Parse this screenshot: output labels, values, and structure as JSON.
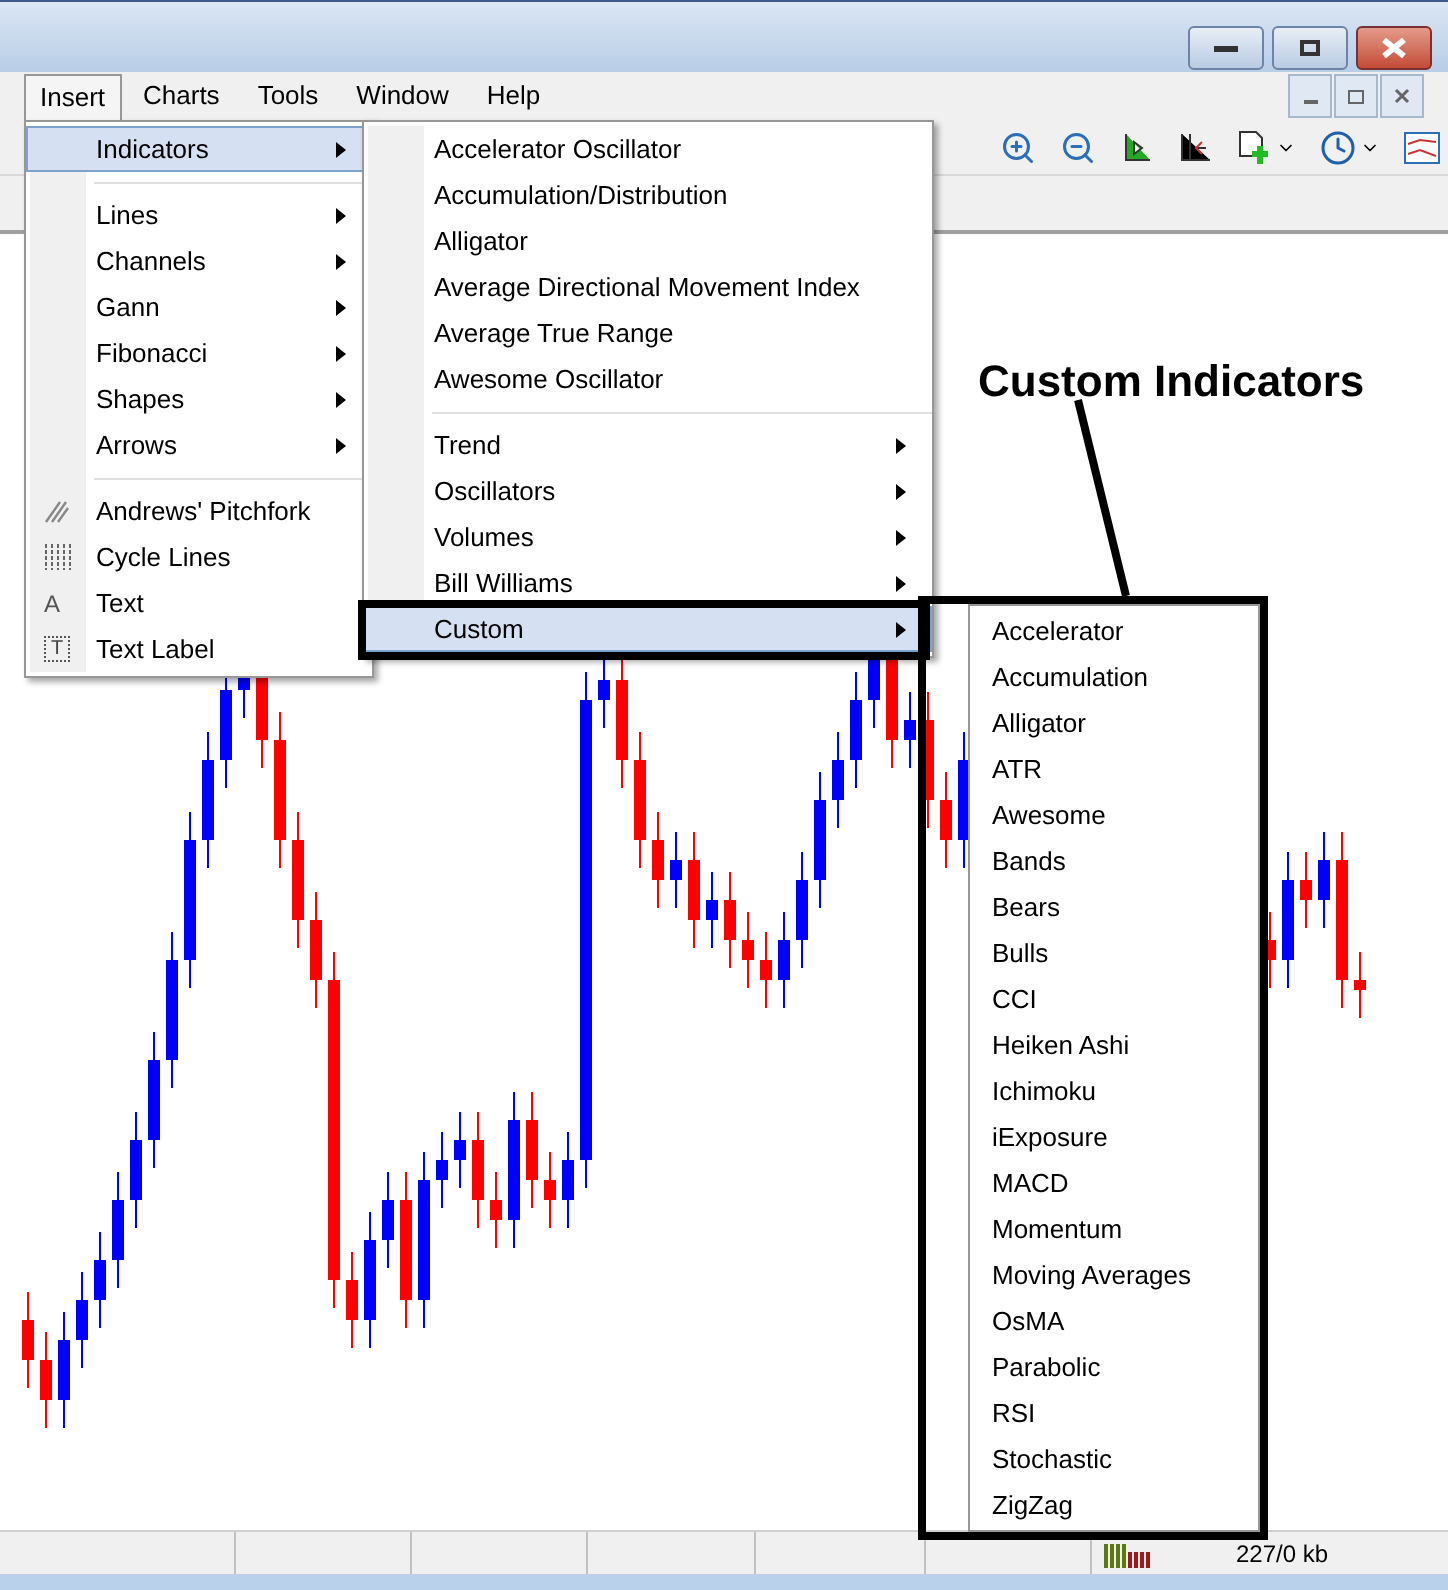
{
  "menu_bar": [
    {
      "label": "Insert",
      "selected": true
    },
    {
      "label": "Charts",
      "selected": false
    },
    {
      "label": "Tools",
      "selected": false
    },
    {
      "label": "Window",
      "selected": false
    },
    {
      "label": "Help",
      "selected": false
    }
  ],
  "insert_menu": {
    "items": [
      {
        "kind": "submenu",
        "label": "Indicators",
        "selected": true
      },
      {
        "kind": "separator"
      },
      {
        "kind": "submenu",
        "label": "Lines",
        "selected": false
      },
      {
        "kind": "submenu",
        "label": "Channels",
        "selected": false
      },
      {
        "kind": "submenu",
        "label": "Gann",
        "selected": false
      },
      {
        "kind": "submenu",
        "label": "Fibonacci",
        "selected": false
      },
      {
        "kind": "submenu",
        "label": "Shapes",
        "selected": false
      },
      {
        "kind": "submenu",
        "label": "Arrows",
        "selected": false
      },
      {
        "kind": "separator"
      },
      {
        "kind": "tool",
        "label": "Andrews' Pitchfork",
        "selected": false
      },
      {
        "kind": "tool",
        "label": "Cycle Lines",
        "selected": false
      },
      {
        "kind": "tool",
        "label": "Text",
        "glyph": "A",
        "selected": false
      },
      {
        "kind": "tool",
        "label": "Text Label",
        "glyph": "T",
        "selected": false
      }
    ]
  },
  "indicators_menu": {
    "items": [
      {
        "kind": "item",
        "label": "Accelerator Oscillator",
        "selected": false
      },
      {
        "kind": "item",
        "label": "Accumulation/Distribution",
        "selected": false
      },
      {
        "kind": "item",
        "label": "Alligator",
        "selected": false
      },
      {
        "kind": "item",
        "label": "Average Directional Movement Index",
        "selected": false
      },
      {
        "kind": "item",
        "label": "Average True Range",
        "selected": false
      },
      {
        "kind": "item",
        "label": "Awesome Oscillator",
        "selected": false
      },
      {
        "kind": "separator"
      },
      {
        "kind": "submenu",
        "label": "Trend",
        "selected": false
      },
      {
        "kind": "submenu",
        "label": "Oscillators",
        "selected": false
      },
      {
        "kind": "submenu",
        "label": "Volumes",
        "selected": false
      },
      {
        "kind": "submenu",
        "label": "Bill Williams",
        "selected": false
      },
      {
        "kind": "submenu",
        "label": "Custom",
        "selected": true
      }
    ]
  },
  "custom_menu": {
    "items": [
      "Accelerator",
      "Accumulation",
      "Alligator",
      "ATR",
      "Awesome",
      "Bands",
      "Bears",
      "Bulls",
      "CCI",
      "Heiken Ashi",
      "Ichimoku",
      "iExposure",
      "MACD",
      "Momentum",
      "Moving Averages",
      "OsMA",
      "Parabolic",
      "RSI",
      "Stochastic",
      "ZigZag"
    ]
  },
  "annotation": {
    "text": "Custom Indicators"
  },
  "status_bar": {
    "traffic": "227/0 kb"
  }
}
